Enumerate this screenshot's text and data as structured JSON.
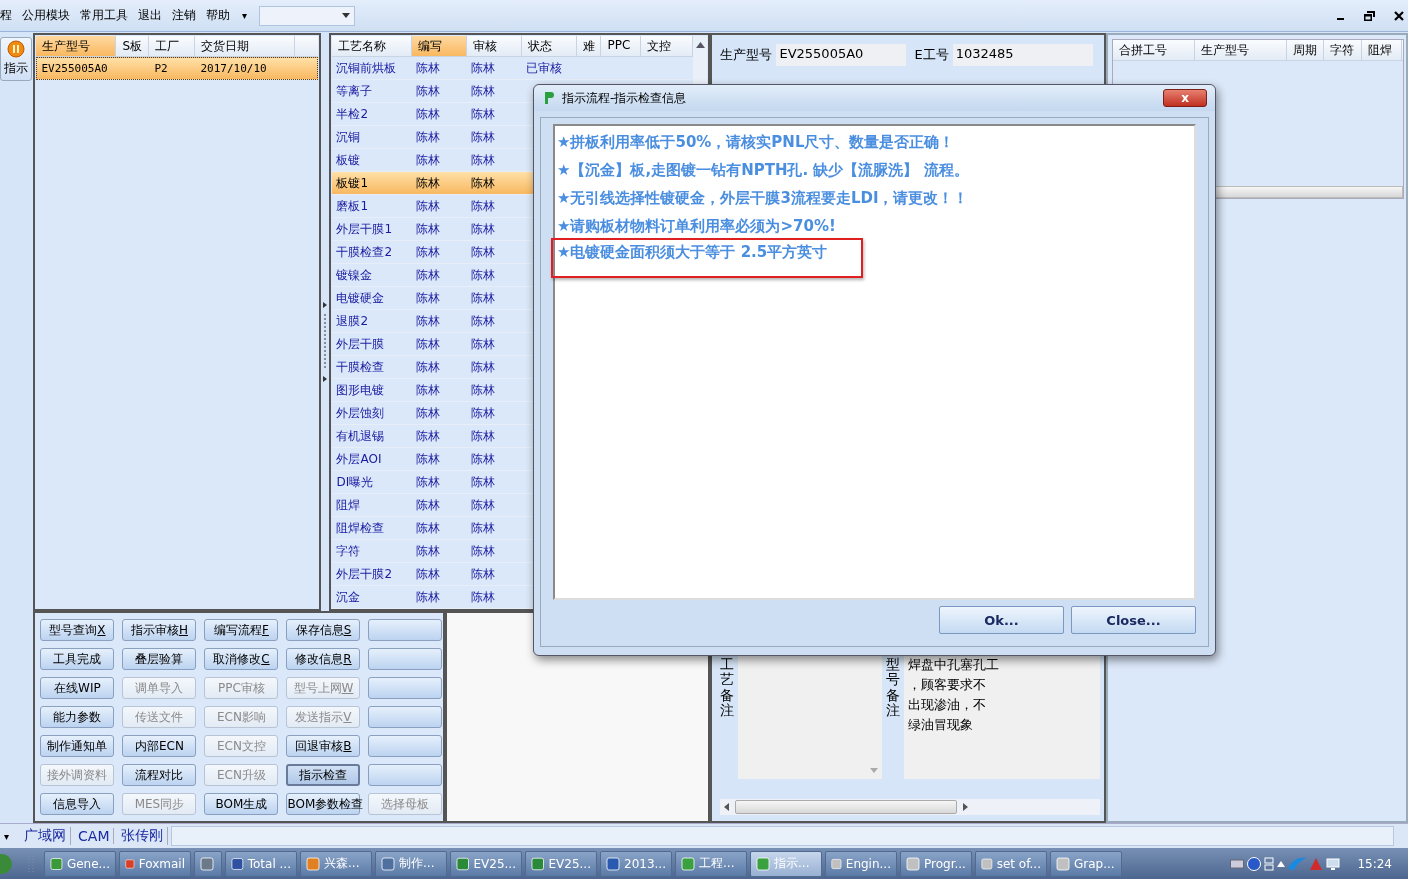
{
  "menu": [
    {
      "label": "程"
    },
    {
      "label": "公用模块"
    },
    {
      "label": "常用工具"
    },
    {
      "label": "退出"
    },
    {
      "label": "注销"
    },
    {
      "label": "帮助"
    }
  ],
  "menu_caret": "▾",
  "side_button": {
    "label": "指示"
  },
  "order_list": {
    "columns": [
      {
        "label": "生产型号",
        "sorted": true
      },
      {
        "label": "S板",
        "sorted": false
      },
      {
        "label": "工厂",
        "sorted": false
      },
      {
        "label": "交货日期",
        "sorted": false
      }
    ],
    "rows": [
      {
        "selected": true,
        "cells": [
          "EV255005A0",
          "",
          "P2",
          "2017/10/10"
        ]
      }
    ]
  },
  "process_table": {
    "columns": [
      {
        "label": "工艺名称",
        "sorted": false
      },
      {
        "label": "编写",
        "sorted": true
      },
      {
        "label": "审核",
        "sorted": false
      },
      {
        "label": "状态",
        "sorted": false
      },
      {
        "label": "难",
        "sorted": false
      },
      {
        "label": "PPC",
        "sorted": false
      },
      {
        "label": "文控",
        "sorted": false
      }
    ],
    "rows": [
      {
        "selected": false,
        "cells": [
          "沉铜前烘板",
          "陈林",
          "陈林",
          "已审核"
        ]
      },
      {
        "selected": false,
        "cells": [
          "等离子",
          "陈林",
          "陈林"
        ]
      },
      {
        "selected": false,
        "cells": [
          "半检2",
          "陈林",
          "陈林"
        ]
      },
      {
        "selected": false,
        "cells": [
          "沉铜",
          "陈林",
          "陈林"
        ]
      },
      {
        "selected": false,
        "cells": [
          "板镀",
          "陈林",
          "陈林"
        ]
      },
      {
        "selected": true,
        "cells": [
          "板镀1",
          "陈林",
          "陈林"
        ]
      },
      {
        "selected": false,
        "cells": [
          "磨板1",
          "陈林",
          "陈林"
        ]
      },
      {
        "selected": false,
        "cells": [
          "外层干膜1",
          "陈林",
          "陈林"
        ]
      },
      {
        "selected": false,
        "cells": [
          "干膜检查2",
          "陈林",
          "陈林"
        ]
      },
      {
        "selected": false,
        "cells": [
          "镀镍金",
          "陈林",
          "陈林"
        ]
      },
      {
        "selected": false,
        "cells": [
          "电镀硬金",
          "陈林",
          "陈林"
        ]
      },
      {
        "selected": false,
        "cells": [
          "退膜2",
          "陈林",
          "陈林"
        ]
      },
      {
        "selected": false,
        "cells": [
          "外层干膜",
          "陈林",
          "陈林"
        ]
      },
      {
        "selected": false,
        "cells": [
          "干膜检查",
          "陈林",
          "陈林"
        ]
      },
      {
        "selected": false,
        "cells": [
          "图形电镀",
          "陈林",
          "陈林"
        ]
      },
      {
        "selected": false,
        "cells": [
          "外层蚀刻",
          "陈林",
          "陈林"
        ]
      },
      {
        "selected": false,
        "cells": [
          "有机退锡",
          "陈林",
          "陈林"
        ]
      },
      {
        "selected": false,
        "cells": [
          "外层AOI",
          "陈林",
          "陈林"
        ]
      },
      {
        "selected": false,
        "cells": [
          "DI曝光",
          "陈林",
          "陈林"
        ]
      },
      {
        "selected": false,
        "cells": [
          "阻焊",
          "陈林",
          "陈林"
        ]
      },
      {
        "selected": false,
        "cells": [
          "阻焊检查",
          "陈林",
          "陈林"
        ]
      },
      {
        "selected": false,
        "cells": [
          "字符",
          "陈林",
          "陈林"
        ]
      },
      {
        "selected": false,
        "cells": [
          "外层干膜2",
          "陈林",
          "陈林"
        ]
      },
      {
        "selected": false,
        "cells": [
          "沉金",
          "陈林",
          "陈林"
        ]
      }
    ]
  },
  "buttons": [
    {
      "label": "型号查询",
      "key": "X",
      "disabled": false,
      "selected": false
    },
    {
      "label": "指示审核",
      "key": "H",
      "disabled": false,
      "selected": false
    },
    {
      "label": "编写流程",
      "key": "F",
      "disabled": false,
      "selected": false
    },
    {
      "label": "保存信息",
      "key": "S",
      "disabled": false,
      "selected": false
    },
    {
      "disabled": false,
      "selected": false
    },
    {
      "label": "工具完成",
      "disabled": false,
      "selected": false
    },
    {
      "label": "叠层验算",
      "disabled": false,
      "selected": false
    },
    {
      "label": "取消修改",
      "key": "C",
      "disabled": false,
      "selected": false
    },
    {
      "label": "修改信息",
      "key": "R",
      "disabled": false,
      "selected": false
    },
    {
      "disabled": false,
      "selected": false
    },
    {
      "label": "在线WIP",
      "disabled": false,
      "selected": false
    },
    {
      "label": "调单导入",
      "disabled": true,
      "selected": false
    },
    {
      "label": "PPC审核",
      "disabled": true,
      "selected": false
    },
    {
      "label": "型号上网",
      "key": "W",
      "disabled": true,
      "selected": false
    },
    {
      "disabled": false,
      "selected": false
    },
    {
      "label": "能力参数",
      "disabled": false,
      "selected": false
    },
    {
      "label": "传送文件",
      "disabled": true,
      "selected": false
    },
    {
      "label": "ECN影响",
      "disabled": true,
      "selected": false
    },
    {
      "label": "发送指示",
      "key": "V",
      "disabled": true,
      "selected": false
    },
    {
      "disabled": false,
      "selected": false
    },
    {
      "label": "制作通知单",
      "disabled": false,
      "selected": false
    },
    {
      "label": "内部ECN",
      "disabled": false,
      "selected": false
    },
    {
      "label": "ECN文控",
      "disabled": true,
      "selected": false
    },
    {
      "label": "回退审核",
      "key": "B",
      "disabled": false,
      "selected": false
    },
    {
      "disabled": false,
      "selected": false
    },
    {
      "label": "接外调资料",
      "disabled": true,
      "selected": false
    },
    {
      "label": "流程对比",
      "disabled": false,
      "selected": false
    },
    {
      "label": "ECN升级",
      "disabled": true,
      "selected": false
    },
    {
      "label": "指示检查",
      "disabled": false,
      "selected": true
    },
    {
      "disabled": false,
      "selected": false
    },
    {
      "label": "信息导入",
      "disabled": false,
      "selected": false
    },
    {
      "label": "MES同步",
      "disabled": true,
      "selected": false
    },
    {
      "label": "BOM生成",
      "disabled": false,
      "selected": false
    },
    {
      "label": "BOM参数检查",
      "disabled": false,
      "selected": false
    },
    {
      "label": "选择母板",
      "disabled": true,
      "selected": false
    }
  ],
  "info": {
    "rows": [
      [
        {
          "label": "生产型号",
          "value": "EV255005A0"
        },
        {
          "label": "E工号",
          "value": "1032485"
        }
      ]
    ],
    "process_note": {
      "label": "工艺备注"
    },
    "model_note": {
      "label": "型号备注",
      "lines": [
        "焊盘中孔塞孔工",
        "，顾客要求不",
        "出现渗油，不",
        "绿油冒现象"
      ]
    }
  },
  "merge_table": {
    "columns": [
      "合拼工号",
      "生产型号",
      "周期",
      "字符",
      "阻焊"
    ]
  },
  "dialog": {
    "title": "指示流程-指示检查信息",
    "close": "x",
    "lines": [
      {
        "text": "★拼板利用率低于50%，请核实PNL尺寸、数量是否正确！",
        "highlighted": false
      },
      {
        "text": "★【沉金】板,走图镀一钻有NPTH孔. 缺少【流脲洗】 流程。",
        "highlighted": false
      },
      {
        "text": "★无引线选择性镀硬金，外层干膜3流程要走LDI，请更改！！",
        "highlighted": false
      },
      {
        "text": "★请购板材物料订单利用率必须为>70%!",
        "highlighted": false
      },
      {
        "text": "★电镀硬金面积须大于等于 2.5平方英寸",
        "highlighted": true
      }
    ],
    "buttons": [
      "Ok...",
      "Close..."
    ]
  },
  "status_bar": {
    "caret": "▾",
    "items": [
      "广域网",
      "CAM",
      "张传刚"
    ]
  },
  "taskbar": {
    "items": [
      {
        "label": "Gene...",
        "kind": "globe",
        "selected": false
      },
      {
        "label": "Foxmail",
        "kind": "mail",
        "selected": false
      },
      {
        "kind": "calc",
        "selected": false
      },
      {
        "label": "Total ...",
        "kind": "disk",
        "selected": false
      },
      {
        "label": "兴森...",
        "kind": "star",
        "selected": false
      },
      {
        "label": "制作...",
        "kind": "doc",
        "selected": false
      },
      {
        "label": "EV25...",
        "kind": "sheet",
        "selected": false
      },
      {
        "label": "EV25...",
        "kind": "sheet",
        "selected": false
      },
      {
        "label": "2013...",
        "kind": "word",
        "selected": false
      },
      {
        "label": "工程...",
        "kind": "app",
        "selected": false
      },
      {
        "label": "指示...",
        "kind": "app",
        "selected": true
      },
      {
        "label": "Engin...",
        "kind": "window",
        "selected": false
      },
      {
        "label": "Progr...",
        "kind": "window",
        "selected": false
      },
      {
        "label": "set of...",
        "kind": "window",
        "selected": false
      },
      {
        "label": "Grap...",
        "kind": "window",
        "selected": false
      }
    ],
    "clock": "15:24"
  }
}
